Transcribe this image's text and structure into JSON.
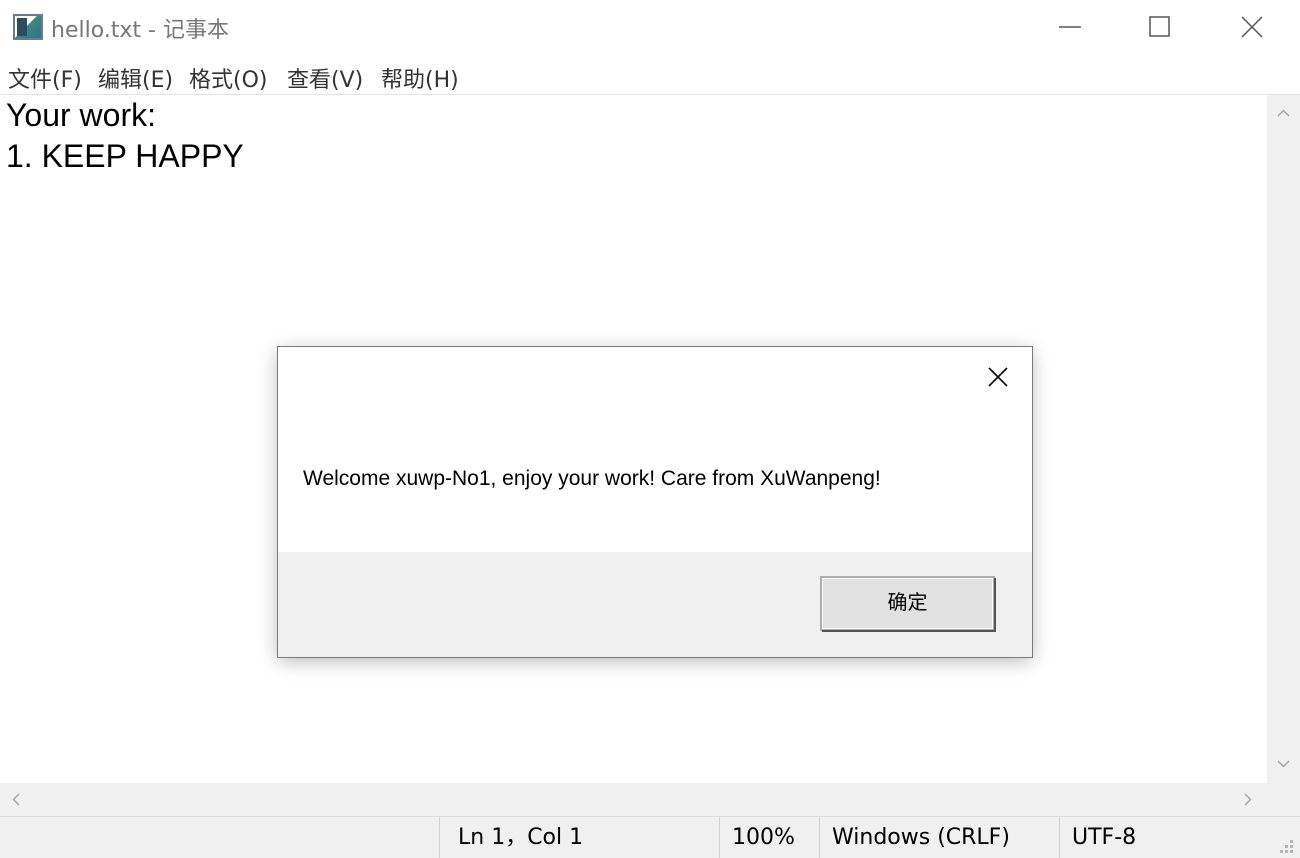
{
  "window": {
    "title": "hello.txt - 记事本"
  },
  "menu": {
    "items": [
      "文件(F)",
      "编辑(E)",
      "格式(O)",
      "查看(V)",
      "帮助(H)"
    ]
  },
  "editor": {
    "lines": [
      "Your work:",
      "1. KEEP HAPPY"
    ]
  },
  "status": {
    "position": "Ln 1，Col 1",
    "zoom": "100%",
    "line_ending": "Windows (CRLF)",
    "encoding": "UTF-8"
  },
  "dialog": {
    "message": "Welcome xuwp-No1, enjoy your work! Care from XuWanpeng!",
    "ok_label": "确定"
  },
  "colors": {
    "dialog_footer": "#f0f0f0",
    "status_bar": "#f0f0f0",
    "title_text": "#777777"
  }
}
